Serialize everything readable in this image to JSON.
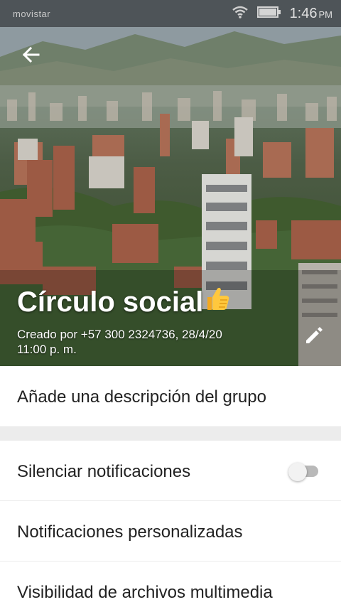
{
  "status_bar": {
    "carrier": "movistar",
    "time": "1:46",
    "ampm": "PM"
  },
  "header": {
    "title": "Círculo social",
    "created_line1": "Creado por +57 300 2324736, 28/4/20",
    "created_line2": "11:00 p. m."
  },
  "description": {
    "placeholder": "Añade una descripción del grupo"
  },
  "settings": {
    "mute_label": "Silenciar notificaciones",
    "mute_enabled": false,
    "custom_notifications_label": "Notificaciones personalizadas",
    "media_visibility_label": "Visibilidad de archivos multimedia"
  },
  "colors": {
    "toggle_off_track": "#b9b9b9",
    "toggle_off_knob": "#f2f2f2",
    "text": "#222222"
  },
  "icons": [
    "back-arrow-icon",
    "wifi-icon",
    "battery-icon",
    "thumbs-up-icon",
    "pencil-icon"
  ]
}
